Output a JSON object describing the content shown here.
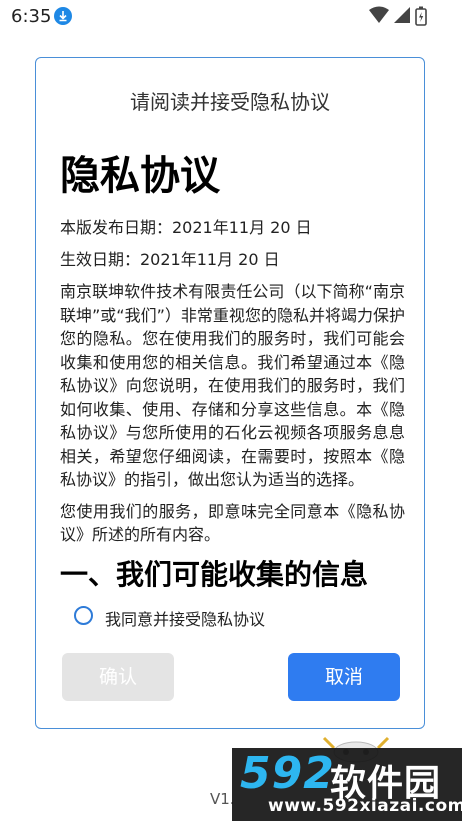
{
  "status_bar": {
    "time": "6:35"
  },
  "dialog": {
    "title": "请阅读并接受隐私协议",
    "doc_heading": "隐私协议",
    "publish_date": "本版发布日期：2021年11月 20 日",
    "effective_date": "生效日期：2021年11月 20 日",
    "paragraph_1": "南京联坤软件技术有限责任公司（以下简称“南京联坤”或“我们”）非常重视您的隐私并将竭力保护您的隐私。您在使用我们的服务时，我们可能会收集和使用您的相关信息。我们希望通过本《隐私协议》向您说明，在使用我们的服务时，我们如何收集、使用、存储和分享这些信息。本《隐私协议》与您所使用的石化云视频各项服务息息相关，希望您仔细阅读，在需要时，按照本《隐私协议》的指引，做出您认为适当的选择。",
    "paragraph_2": "您使用我们的服务，即意味完全同意本《隐私协议》所述的所有内容。",
    "section_heading": "一、我们可能收集的信息",
    "agree_label": "我同意并接受隐私协议",
    "agree_checked": false,
    "confirm_label": "确认",
    "cancel_label": "取消"
  },
  "background": {
    "version_text": "V1."
  },
  "watermark": {
    "number": "592",
    "brand": "软件园",
    "url": "www.592xiazai.com"
  },
  "colors": {
    "accent": "#2f7cf0",
    "dialog_border": "#4a8fd8",
    "confirm_disabled": "#e4e4e4"
  }
}
